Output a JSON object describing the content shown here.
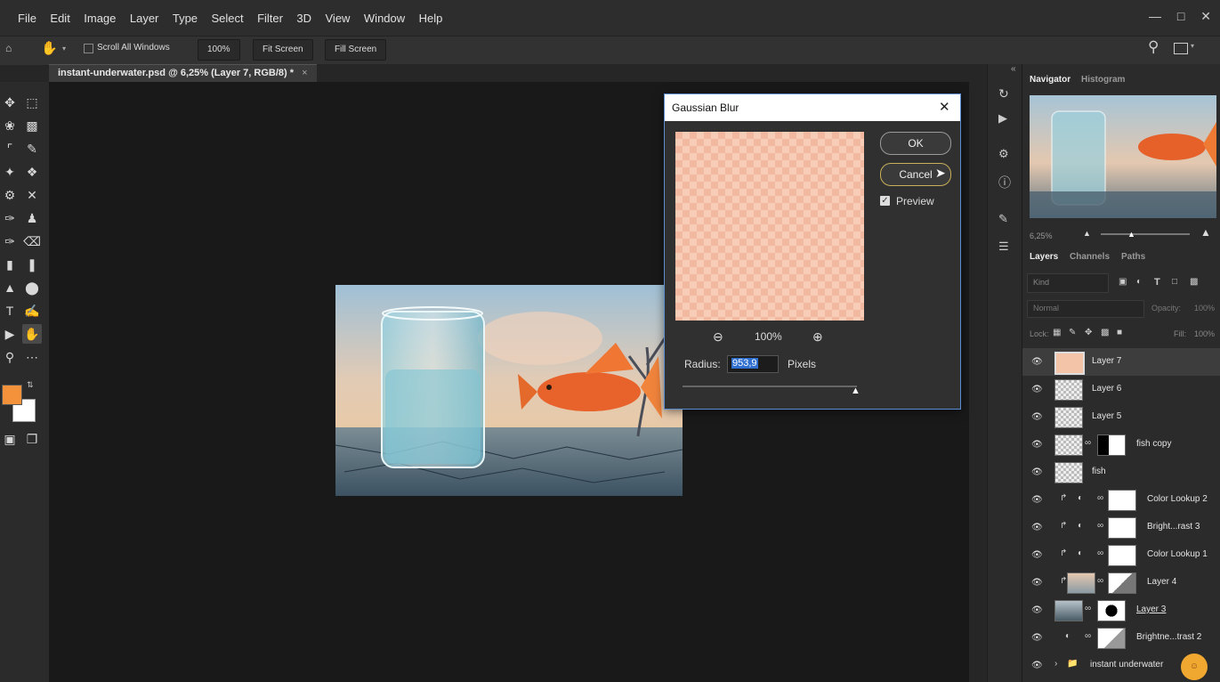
{
  "menu": [
    "File",
    "Edit",
    "Image",
    "Layer",
    "Type",
    "Select",
    "Filter",
    "3D",
    "View",
    "Window",
    "Help"
  ],
  "window_controls": [
    "—",
    "□",
    "✕"
  ],
  "options": {
    "scroll_all": "Scroll All Windows",
    "zoom_btn": "100%",
    "fit_btn": "Fit Screen",
    "fill_btn": "Fill Screen"
  },
  "document": {
    "tab_title": "instant-underwater.psd @ 6,25% (Layer 7, RGB/8) *",
    "tab_close": "×"
  },
  "colors": {
    "foreground": "#f3923a",
    "background": "#ffffff",
    "accent": "#5a8ed0"
  },
  "dialog": {
    "title": "Gaussian Blur",
    "close": "✕",
    "zoom": "100%",
    "ok": "OK",
    "cancel": "Cancel",
    "preview_label": "Preview",
    "preview_checked": true,
    "radius_label": "Radius:",
    "radius_value": "953,9",
    "radius_unit": "Pixels"
  },
  "panels": {
    "collapse": "«",
    "navigator_tabs": [
      "Navigator",
      "Histogram"
    ],
    "nav_zoom": "6,25%",
    "layer_tabs": [
      "Layers",
      "Channels",
      "Paths"
    ],
    "filter_kind": "Kind",
    "blend_mode": "Normal",
    "opacity_label": "Opacity:",
    "opacity_value": "100%",
    "lock_label": "Lock:",
    "fill_label": "Fill:",
    "fill_value": "100%"
  },
  "layers": [
    {
      "name": "Layer 7",
      "selected": true
    },
    {
      "name": "Layer 6"
    },
    {
      "name": "Layer 5"
    },
    {
      "name": "fish copy"
    },
    {
      "name": "fish"
    },
    {
      "name": "Color Lookup 2"
    },
    {
      "name": "Bright...rast 3"
    },
    {
      "name": "Color Lookup 1"
    },
    {
      "name": "Layer 4"
    },
    {
      "name": "Layer 3"
    },
    {
      "name": "Brightne...trast 2"
    },
    {
      "name": "instant underwater"
    }
  ]
}
